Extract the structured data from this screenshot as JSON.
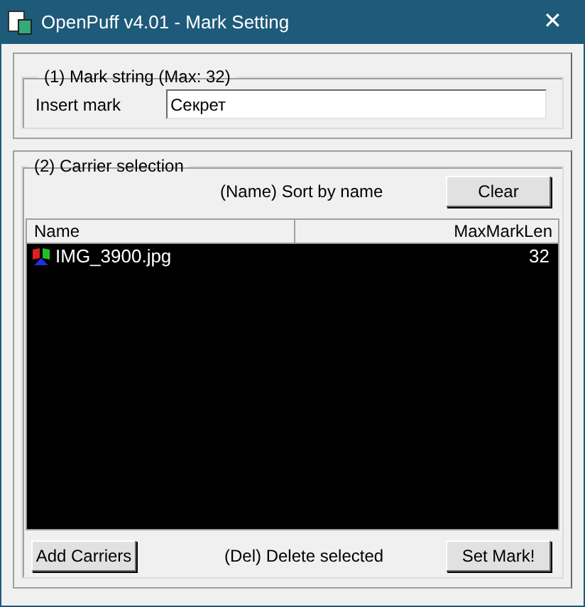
{
  "window": {
    "title": "OpenPuff v4.01 - Mark Setting",
    "close": "✕"
  },
  "mark_group": {
    "title": "(1)  Mark string (Max: 32)",
    "label": "Insert mark",
    "value": "Секрет"
  },
  "carrier_group": {
    "title": "(2)  Carrier selection",
    "sort_hint": "(Name) Sort by name",
    "clear_button": "Clear",
    "columns": [
      "Name",
      "MaxMarkLen"
    ],
    "rows": [
      {
        "name": "IMG_3900.jpg",
        "max_mark_len": "32"
      }
    ],
    "add_button": "Add Carriers",
    "delete_hint": "(Del) Delete selected",
    "set_button": "Set Mark!"
  }
}
